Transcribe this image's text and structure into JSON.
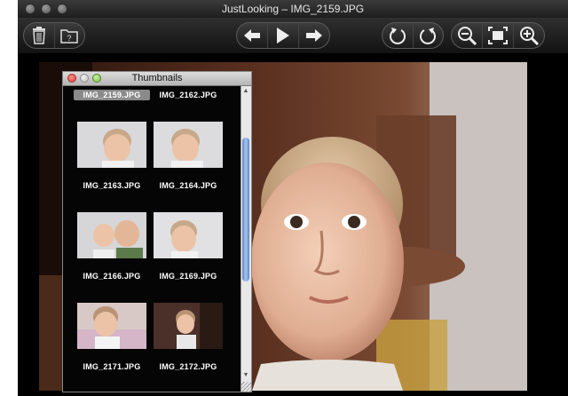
{
  "window": {
    "title": "JustLooking – IMG_2159.JPG"
  },
  "toolbar": {
    "left_group": [
      {
        "icon": "trash-icon",
        "label": "Delete"
      },
      {
        "icon": "info-icon",
        "label": "Info"
      }
    ],
    "nav_group": [
      {
        "icon": "arrow-left-icon",
        "label": "Previous"
      },
      {
        "icon": "play-icon",
        "label": "Slideshow"
      },
      {
        "icon": "arrow-right-icon",
        "label": "Next"
      }
    ],
    "rotate_group": [
      {
        "icon": "rotate-left-icon",
        "label": "Rotate Left"
      },
      {
        "icon": "rotate-right-icon",
        "label": "Rotate Right"
      }
    ],
    "zoom_group": [
      {
        "icon": "zoom-out-icon",
        "label": "Zoom Out"
      },
      {
        "icon": "fit-screen-icon",
        "label": "Fit"
      },
      {
        "icon": "zoom-in-icon",
        "label": "Zoom In"
      }
    ]
  },
  "thumbnails_panel": {
    "title": "Thumbnails",
    "items": [
      {
        "name": "IMG_2159.JPG",
        "selected": true
      },
      {
        "name": "IMG_2162.JPG"
      },
      {
        "name": "IMG_2163.JPG"
      },
      {
        "name": "IMG_2164.JPG"
      },
      {
        "name": "IMG_2166.JPG"
      },
      {
        "name": "IMG_2169.JPG"
      },
      {
        "name": "IMG_2171.JPG"
      },
      {
        "name": "IMG_2172.JPG"
      }
    ]
  },
  "colors": {
    "selection": "#8a8a8a",
    "scroll_thumb": "#7aa0dd",
    "close_button": "#e0443e"
  }
}
